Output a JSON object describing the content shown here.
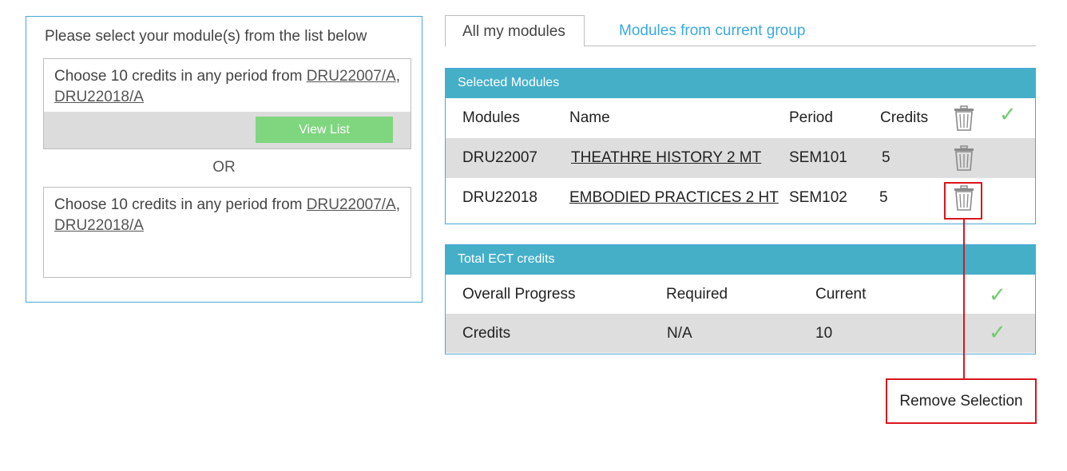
{
  "left_panel": {
    "title": "Please select your module(s) from the list below",
    "rules": [
      {
        "prefix": "Choose 10 credits in any period from ",
        "module_a": "DRU22007/A",
        "separator": ",",
        "module_b": "DRU22018/A",
        "button_label": "View List"
      },
      {
        "prefix": "Choose 10 credits in any period from ",
        "module_a": "DRU22007/A",
        "separator": ",",
        "module_b": "DRU22018/A"
      }
    ],
    "or_label": "OR"
  },
  "tabs": {
    "all_modules": "All my modules",
    "current_group": "Modules from current group"
  },
  "selected_modules": {
    "header": "Selected Modules",
    "columns": {
      "modules": "Modules",
      "name": "Name",
      "period": "Period",
      "credits": "Credits"
    },
    "rows": [
      {
        "code": "DRU22007",
        "name": "THEATHRE HISTORY 2 MT",
        "period": "SEM101",
        "credits": "5"
      },
      {
        "code": "DRU22018",
        "name": "EMBODIED PRACTICES 2 HT",
        "period": "SEM102",
        "credits": "5"
      }
    ]
  },
  "total_credits": {
    "header": "Total ECT credits",
    "columns": {
      "label": "Overall Progress",
      "required": "Required",
      "current": "Current"
    },
    "row": {
      "label": "Credits",
      "required": "N/A",
      "current": "10"
    }
  },
  "callout": {
    "label": "Remove Selection"
  },
  "colors": {
    "panel_border": "#4aa8d8",
    "header_bg": "#45afc8",
    "check": "#6dcd6d",
    "button_bg": "#7fd67f",
    "tab_link": "#3aa9df",
    "callout": "#d9161c"
  }
}
